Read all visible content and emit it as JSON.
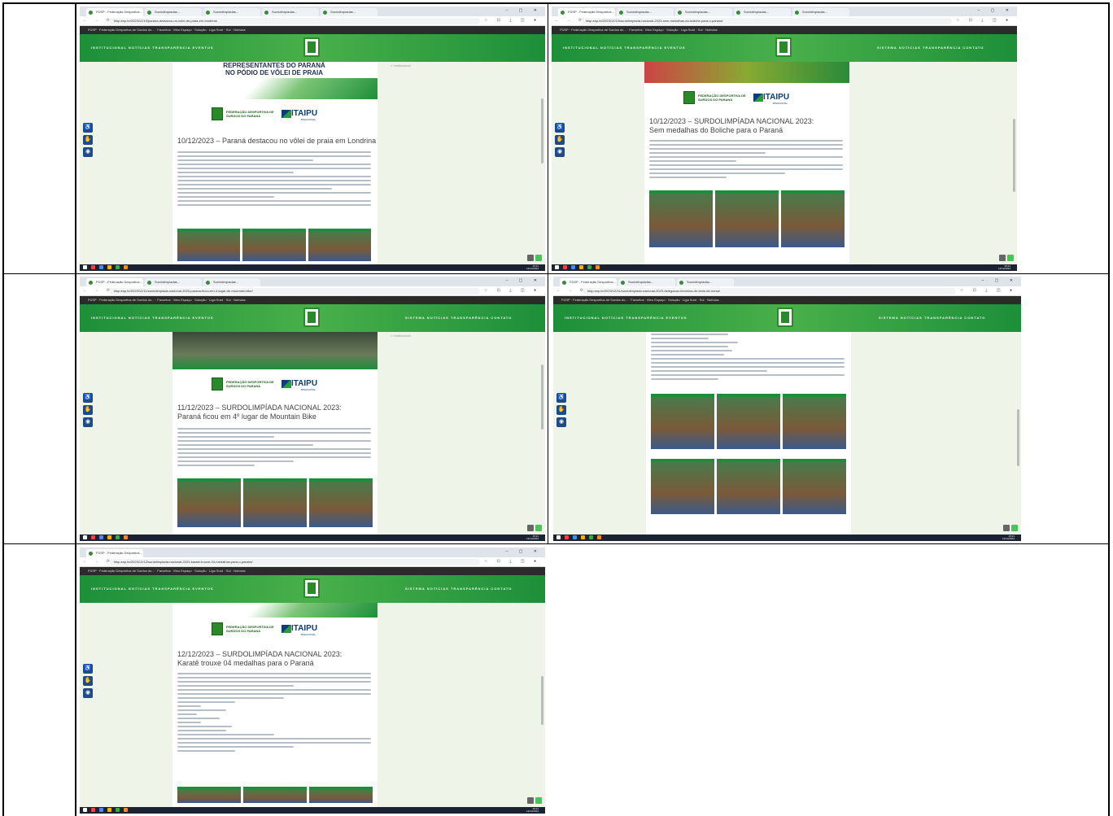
{
  "brand": {
    "green": "#2a9a3a",
    "dark_green": "#1d8f3a",
    "itaipu_blue": "#0b3f7a"
  },
  "common": {
    "window_controls": "–  ▢  ✕",
    "nav_buttons": "←  →  ⟳",
    "addr_icons": "☆ ⊡ ⤓ ◫ ●",
    "bookmarks": "FDSP · Federação Desportiva de Surdos do... · Favoritos · Meu Espaço · Solução · Liga Surd · Sul · Notícias",
    "site_menu_left": "INSTITUCIONAL    NOTÍCIAS    TRANSPARÊNCIA    EVENTOS",
    "site_menu_right": "SISTEMA    NOTÍCIAS    TRANSPARÊNCIA    CONTATO",
    "fdsp_name": "FEDERAÇÃO DESPORTIVA DE SURDOS DO PARANÁ",
    "itaipu": "ITAIPU",
    "itaipu_sub": "BINACIONAL",
    "clock_time": "15:21",
    "clock_date": "13/12/2023",
    "side_icons": [
      "accessibility-icon",
      "sign-language-icon",
      "eye-icon"
    ]
  },
  "screens": [
    {
      "id": "s1",
      "tabs": [
        "FDSP - Federação Desportiva...",
        "Surdolimpíadas...",
        "Surdolimpíadas...",
        "Surdolimpíadas...",
        "Surdolimpíadas..."
      ],
      "url": "fdsp.esp.br/2023/12/10/parana-destacou-no-volei-de-praia-em-londrina/",
      "banner": "REPRESENTANTES DO PARANÁ\nNO PÓDIO DE VÔLEI DE PRAIA",
      "headline": "10/12/2023 – Paraná destacou no vôlei de praia em Londrina",
      "sidebar_link": "« Institucional"
    },
    {
      "id": "s2",
      "tabs": [
        "FDSP - Federação Desportiva...",
        "Surdolimpíadas...",
        "Surdolimpíadas...",
        "Surdolimpíadas...",
        "Surdolimpíadas..."
      ],
      "url": "fdsp.esp.br/2023/12/10/surdolimpiada-nacional-2023-sem-medalhas-do-boliche-para-o-parana/",
      "headline": "10/12/2023 – SURDOLIMPÍADA NACIONAL 2023: Sem medalhas do Boliche para o Paraná"
    },
    {
      "id": "s3",
      "tabs": [
        "FDSP - Federação Desportiva...",
        "Surdolimpíadas...",
        "Surdolimpíadas..."
      ],
      "url": "fdsp.esp.br/2023/12/11/surdolimpiada-nacional-2023-parana-ficou-em-4-lugar-de-mountain-bike/",
      "headline": "11/12/2023 – SURDOLIMPÍADA NACIONAL 2023: Paraná ficou em 4º lugar de Mountain Bike",
      "sidebar_link": "« Institucional"
    },
    {
      "id": "s4",
      "tabs": [
        "FDSP - Federação Desportiva...",
        "Surdolimpíadas...",
        "Surdolimpíadas..."
      ],
      "url": "fdsp.esp.br/2023/12/11/surdolimpiada-nacional-2023-delegacao-feminina-de-tenis-de-mesa/"
    },
    {
      "id": "s5",
      "tabs": [
        "FDSP - Federação Desportiva..."
      ],
      "url": "fdsp.esp.br/2023/12/12/surdolimpiada-nacional-2023-karate-trouxe-04-medalhas-para-o-parana/",
      "headline": "12/12/2023 – SURDOLIMPÍADA NACIONAL 2023: Karatê trouxe 04 medalhas para o Paraná"
    }
  ]
}
